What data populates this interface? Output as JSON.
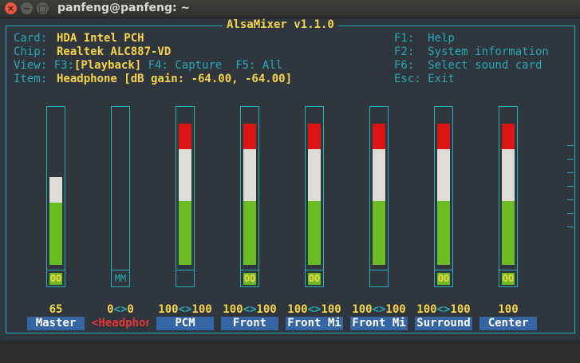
{
  "window": {
    "title": "panfeng@panfeng: ~"
  },
  "app_title": "AlsaMixer v1.1.0",
  "info": {
    "card_label": "Card:",
    "card_value": "HDA Intel PCH",
    "chip_label": "Chip:",
    "chip_value": "Realtek ALC887-VD",
    "view_label": "View:",
    "view_f3": "F3:",
    "view_playback": "[Playback]",
    "view_rest": " F4: Capture  F5: All",
    "item_label": "Item:",
    "item_value": "Headphone [dB gain: -64.00, -64.00]"
  },
  "keys": [
    "F1:  Help",
    "F2:  System information",
    "F6:  Select sound card",
    "Esc: Exit"
  ],
  "controls": [
    {
      "name": "Master",
      "level_text": "65",
      "switch": "OO",
      "red": 0,
      "white": 0.17,
      "green": 0.42
    },
    {
      "name": "<Headphon>",
      "level_text_l": "0",
      "arrows": "<>",
      "level_text_r": "0",
      "switch": "MM",
      "red": 0,
      "white": 0,
      "green": 0
    },
    {
      "name": "PCM",
      "level_text_l": "100",
      "arrows": "<>",
      "level_text_r": "100",
      "switch": "",
      "red": 0.17,
      "white": 0.35,
      "green": 0.43
    },
    {
      "name": "Front",
      "level_text_l": "100",
      "arrows": "<>",
      "level_text_r": "100",
      "switch": "OO",
      "red": 0.17,
      "white": 0.35,
      "green": 0.43
    },
    {
      "name": "Front Mi",
      "level_text_l": "100",
      "arrows": "<>",
      "level_text_r": "100",
      "switch": "OO",
      "red": 0.17,
      "white": 0.35,
      "green": 0.43
    },
    {
      "name": "Front Mi",
      "level_text_l": "100",
      "arrows": "<>",
      "level_text_r": "100",
      "switch": "",
      "red": 0.17,
      "white": 0.35,
      "green": 0.43
    },
    {
      "name": "Surround",
      "level_text_l": "100",
      "arrows": "<>",
      "level_text_r": "100",
      "switch": "OO",
      "red": 0.17,
      "white": 0.35,
      "green": 0.43
    },
    {
      "name": "Center",
      "level_text": "100",
      "switch": "OO",
      "red": 0.17,
      "white": 0.35,
      "green": 0.43
    }
  ],
  "colors": {
    "frame": "#23b0b8",
    "highlight": "#f5d547",
    "selected_name": "#e53535",
    "name_bg": "#3466a5"
  }
}
